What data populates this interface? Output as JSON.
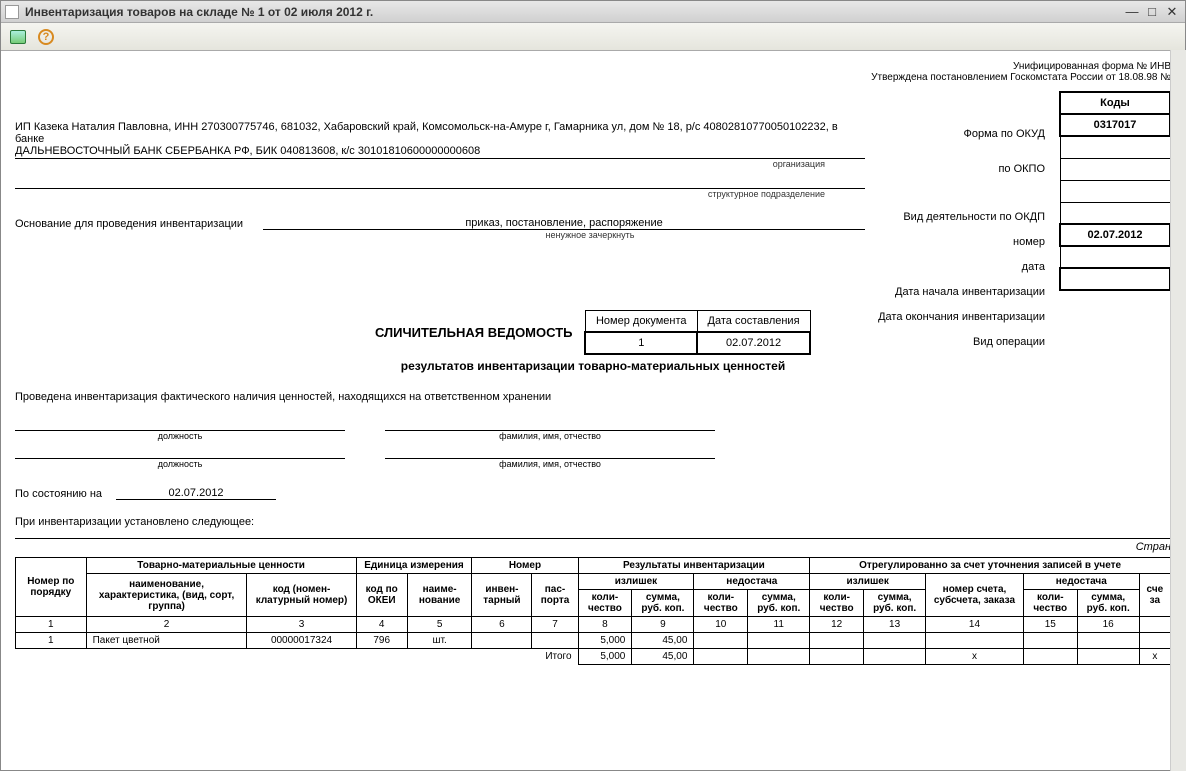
{
  "window": {
    "title": "Инвентаризация товаров на складе № 1 от 02 июля 2012 г."
  },
  "header": {
    "form_line": "Унифицированная форма № ИНВ",
    "approved_line": "Утверждена постановлением Госкомстата России от 18.08.98 №"
  },
  "codes": {
    "header": "Коды",
    "okud_label": "Форма по ОКУД",
    "okud": "0317017",
    "okpo_label": "по ОКПО",
    "okpo": "",
    "okdp_label": "Вид деятельности по ОКДП",
    "okdp": "",
    "number_label": "номер",
    "number": "",
    "date_label": "дата",
    "date": "",
    "start_label": "Дата начала инвентаризации",
    "start": "02.07.2012",
    "end_label": "Дата окончания инвентаризации",
    "end": "",
    "op_label": "Вид операции",
    "op": ""
  },
  "org": {
    "text1": "ИП Казека Наталия Павловна, ИНН 270300775746, 681032, Хабаровский край, Комсомольск-на-Амуре г, Гамарника ул, дом № 18, р/с 40802810770050102232, в банке",
    "text2": "ДАЛЬНЕВОСТОЧНЫЙ БАНК СБЕРБАНКА РФ, БИК 040813608, к/с 30101810600000000608",
    "sub": "организация",
    "struct_sub": "структурное подразделение"
  },
  "basis": {
    "label": "Основание для проведения инвентаризации",
    "value": "приказ, постановление, распоряжение",
    "sub": "ненужное зачеркнуть"
  },
  "doc": {
    "title": "СЛИЧИТЕЛЬНАЯ ВЕДОМОСТЬ",
    "subtitle": "результатов инвентаризации товарно-материальных ценностей",
    "num_hdr": "Номер документа",
    "date_hdr": "Дата составления",
    "num": "1",
    "date": "02.07.2012"
  },
  "intro": "Проведена инвентаризация фактического наличия ценностей, находящихся на ответственном хранении",
  "sign": {
    "pos": "должность",
    "fio": "фамилия, имя, отчество"
  },
  "state": {
    "label": "По состоянию на",
    "value": "02.07.2012"
  },
  "found": "При инвентаризации установлено следующее:",
  "page": "Стран",
  "table": {
    "h_num": "Номер по порядку",
    "h_goods": "Товарно-материальные ценности",
    "h_unit": "Единица измерения",
    "h_number": "Номер",
    "h_results": "Результаты инвентаризации",
    "h_adjust": "Отрегулированно за счет уточнения записей в учете",
    "h_name": "наименование, характеристика, (вид, сорт, группа)",
    "h_code": "код (номен-клатурный номер)",
    "h_okei": "код по ОКЕИ",
    "h_unitname": "наиме-нование",
    "h_inv": "инвен-тарный",
    "h_pass": "пас-порта",
    "h_surplus": "излишек",
    "h_short": "недостача",
    "h_qty": "коли-чество",
    "h_sum": "сумма, руб. коп.",
    "h_acc": "номер счета, субсчета, заказа",
    "h_sch": "сче за",
    "cols": [
      "1",
      "2",
      "3",
      "4",
      "5",
      "6",
      "7",
      "8",
      "9",
      "10",
      "11",
      "12",
      "13",
      "14",
      "15",
      "16",
      ""
    ],
    "row": {
      "n": "1",
      "name": "Пакет цветной",
      "code": "00000017324",
      "okei": "796",
      "unit": "шт.",
      "inv": "",
      "pass": "",
      "sq": "5,000",
      "ss": "45,00",
      "dq": "",
      "ds": "",
      "aq": "",
      "as": "",
      "acc": "",
      "bq": "",
      "bs": ""
    },
    "total_label": "Итого",
    "total": {
      "sq": "5,000",
      "ss": "45,00",
      "x1": "х",
      "x2": "х"
    }
  }
}
